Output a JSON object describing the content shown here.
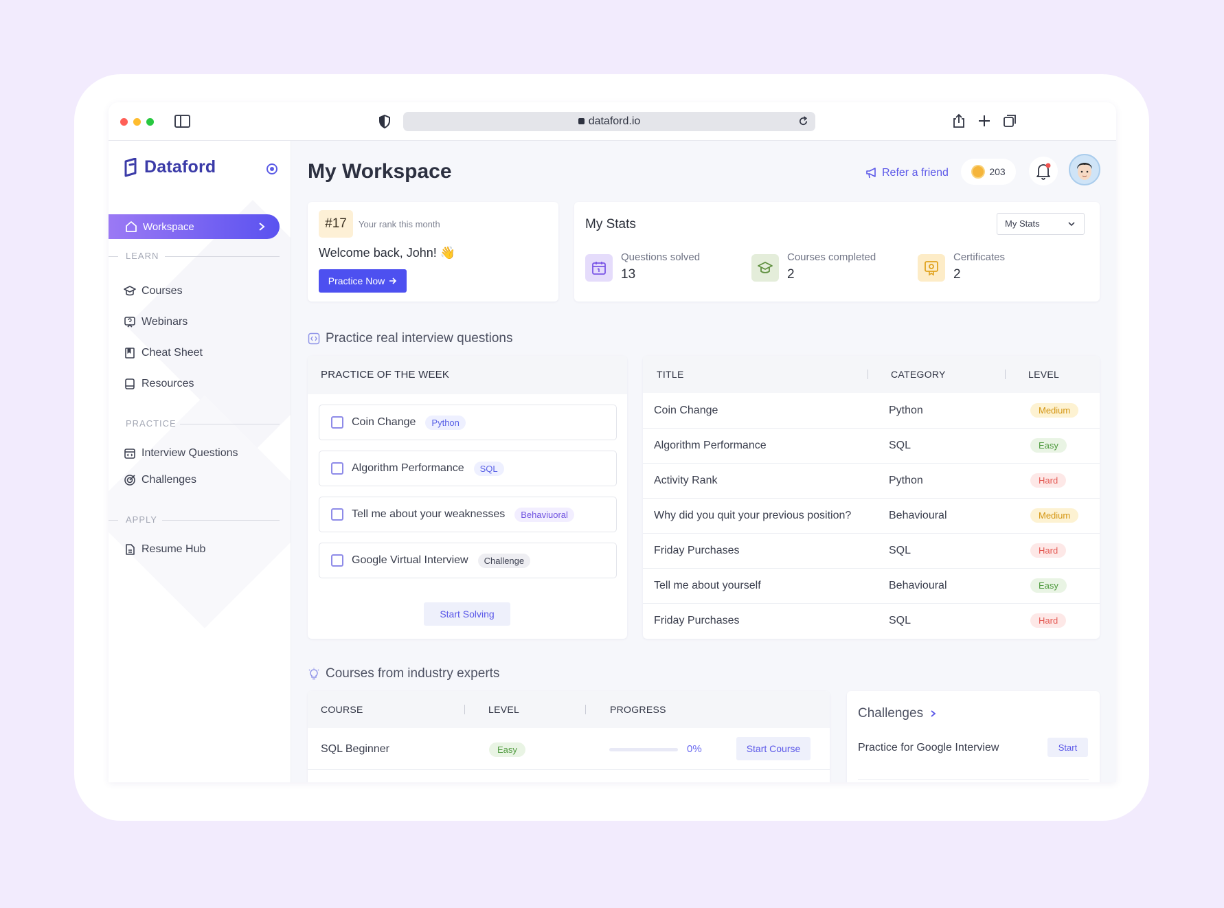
{
  "browser": {
    "url": "dataford.io"
  },
  "brand": {
    "name": "Dataford"
  },
  "sidebar": {
    "active": {
      "label": "Workspace"
    },
    "sections": [
      {
        "label": "LEARN",
        "items": [
          "Courses",
          "Webinars",
          "Cheat Sheet",
          "Resources"
        ]
      },
      {
        "label": "PRACTICE",
        "items": [
          "Interview Questions",
          "Challenges"
        ]
      },
      {
        "label": "APPLY",
        "items": [
          "Resume Hub"
        ]
      }
    ]
  },
  "header": {
    "title": "My Workspace",
    "refer_label": "Refer a friend",
    "coins": "203"
  },
  "rank": {
    "badge": "#17",
    "text": "Your rank this month",
    "welcome": "Welcome back,  John! 👋",
    "cta": "Practice Now"
  },
  "stats": {
    "title": "My Stats",
    "select": "My Stats",
    "items": [
      {
        "label": "Questions solved",
        "value": "13"
      },
      {
        "label": "Courses completed",
        "value": "2"
      },
      {
        "label": "Certificates",
        "value": "2"
      }
    ]
  },
  "practice_section": {
    "title": "Practice real interview questions"
  },
  "potw": {
    "title": "PRACTICE OF THE WEEK",
    "items": [
      {
        "title": "Coin Change",
        "tag": "Python"
      },
      {
        "title": "Algorithm Performance",
        "tag": "SQL"
      },
      {
        "title": "Tell me about your weaknesses",
        "tag": "Behaviuoral"
      },
      {
        "title": "Google Virtual Interview",
        "tag": "Challenge"
      }
    ],
    "cta": "Start Solving"
  },
  "questions_table": {
    "columns": [
      "TITLE",
      "CATEGORY",
      "LEVEL"
    ],
    "rows": [
      {
        "title": "Coin Change",
        "category": "Python",
        "level": "Medium"
      },
      {
        "title": "Algorithm Performance",
        "category": "SQL",
        "level": "Easy"
      },
      {
        "title": "Activity Rank",
        "category": "Python",
        "level": "Hard"
      },
      {
        "title": "Why did you quit your previous position?",
        "category": "Behavioural",
        "level": "Medium"
      },
      {
        "title": "Friday Purchases",
        "category": "SQL",
        "level": "Hard"
      },
      {
        "title": "Tell me about yourself",
        "category": "Behavioural",
        "level": "Easy"
      },
      {
        "title": "Friday Purchases",
        "category": "SQL",
        "level": "Hard"
      }
    ]
  },
  "courses_section": {
    "title": "Courses from industry experts"
  },
  "courses_table": {
    "columns": [
      "COURSE",
      "LEVEL",
      "PROGRESS"
    ],
    "rows": [
      {
        "course": "SQL Beginner",
        "level": "Easy",
        "progress": 0,
        "progress_label": "0%",
        "cta": "Start Course"
      }
    ]
  },
  "challenges": {
    "title": "Challenges",
    "items": [
      {
        "title": "Practice for Google Interview",
        "cta": "Start"
      }
    ]
  },
  "colors": {
    "accent": "#4d50f0",
    "brand": "#3b3ba8",
    "background": "#f2ebfd"
  }
}
